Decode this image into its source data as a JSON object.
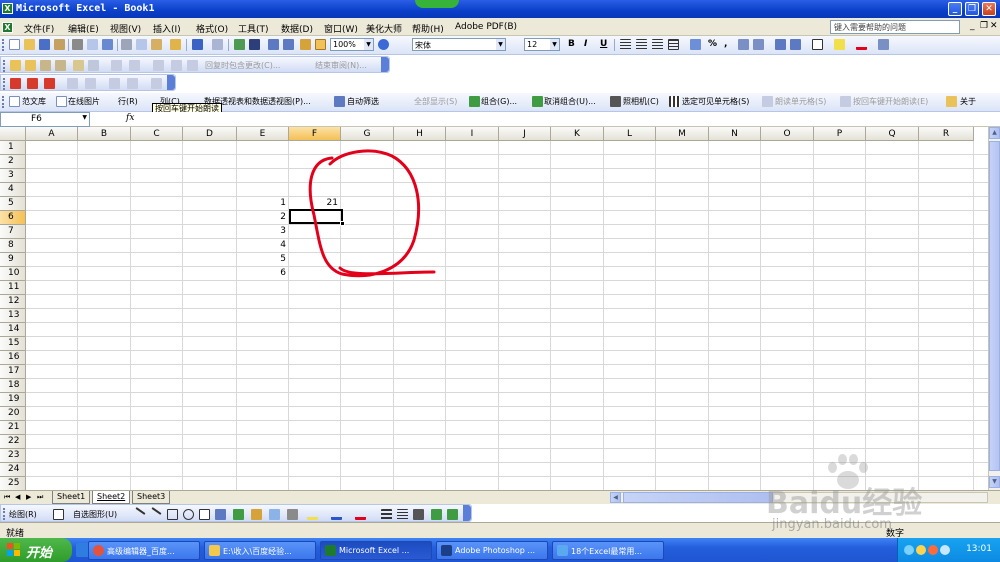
{
  "window": {
    "title": "Microsoft Excel - Book1",
    "controls": [
      "_",
      "❐",
      "✕"
    ]
  },
  "menubar": {
    "items": [
      "文件(F)",
      "编辑(E)",
      "视图(V)",
      "插入(I)",
      "格式(O)",
      "工具(T)",
      "数据(D)",
      "窗口(W)",
      "美化大师",
      "帮助(H)",
      "Adobe PDF(B)"
    ],
    "help_placeholder": "键入需要帮助的问题",
    "doc_controls": [
      "_",
      "❐",
      "✕"
    ]
  },
  "toolbar_standard": {
    "zoom": "100%",
    "font": "宋体",
    "font_size": "12",
    "bold": "B",
    "italic": "I",
    "underline": "U",
    "percent": "%",
    "comma": ","
  },
  "toolbar_review": {
    "reply_changes": "回复时包含更改(C)...",
    "end_review": "结束审阅(N)..."
  },
  "toolbar_tools": {
    "items": [
      "范文库",
      "在线图片",
      "行(R)",
      "列(C)",
      "数据透视表和数据透视图(P)...",
      "自动筛选",
      "全部显示(S)",
      "组合(G)...",
      "取消组合(U)...",
      "照相机(C)",
      "选定可见单元格(S)",
      "朗读单元格(S)",
      "按回车键开始朗读(E)",
      "关于"
    ],
    "tooltip": "按回车键开始朗读"
  },
  "formula_bar": {
    "name_box": "F6",
    "fx": "fx",
    "content": ""
  },
  "grid": {
    "columns": [
      "A",
      "B",
      "C",
      "D",
      "E",
      "F",
      "G",
      "H",
      "I",
      "J",
      "K",
      "L",
      "M",
      "N",
      "O",
      "P",
      "Q",
      "R"
    ],
    "rows": [
      "1",
      "2",
      "3",
      "4",
      "5",
      "6",
      "7",
      "8",
      "9",
      "10",
      "11",
      "12",
      "13",
      "14",
      "15",
      "16",
      "17",
      "18",
      "19",
      "20",
      "21",
      "22",
      "23",
      "24",
      "25"
    ],
    "selected_column": "F",
    "selected_row": "6",
    "cells": [
      {
        "ref": "E5",
        "value": "1"
      },
      {
        "ref": "E6",
        "value": "2"
      },
      {
        "ref": "E7",
        "value": "3"
      },
      {
        "ref": "E8",
        "value": "4"
      },
      {
        "ref": "E9",
        "value": "5"
      },
      {
        "ref": "E10",
        "value": "6"
      },
      {
        "ref": "F5",
        "value": "21"
      }
    ]
  },
  "sheet_tabs": {
    "nav": [
      "⏮",
      "◀",
      "▶",
      "⏭"
    ],
    "tabs": [
      "Sheet1",
      "Sheet2",
      "Sheet3"
    ],
    "active": "Sheet2"
  },
  "drawing_toolbar": {
    "draw": "绘图(R)",
    "autoshapes": "自选图形(U)"
  },
  "status": {
    "left": "就绪",
    "right": "数字"
  },
  "taskbar": {
    "start": "开始",
    "tasks": [
      "高级编辑器_百度...",
      "E:\\收入\\百度经验...",
      "Microsoft Excel ...",
      "Adobe Photoshop ...",
      "18个Excel最常用..."
    ],
    "active_task": "Microsoft Excel ...",
    "clock": "13:01"
  },
  "watermark": {
    "logo": "Baidu经验",
    "url": "jingyan.baidu.com"
  },
  "colors": {
    "titlebar": "#0a3fc9",
    "annotation_red": "#e3001b",
    "selected_header": "#f5c054",
    "taskbar": "#245edb",
    "start": "#2e9c2a"
  }
}
